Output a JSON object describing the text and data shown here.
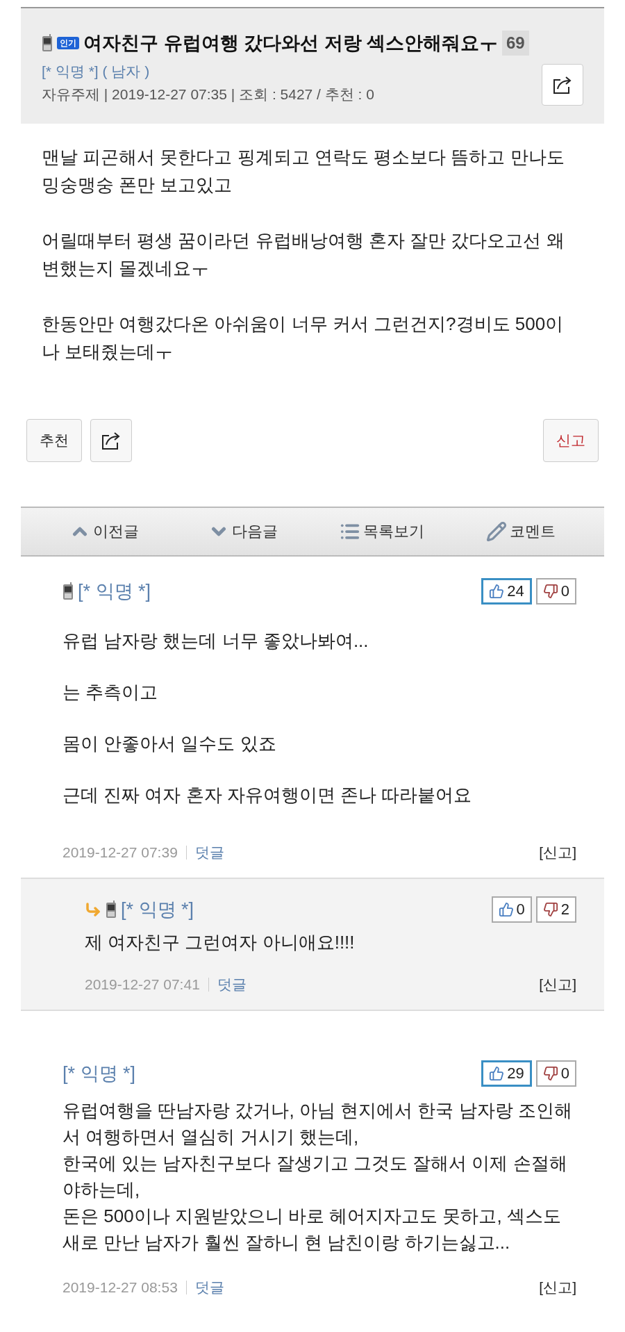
{
  "post": {
    "mobile": true,
    "badge": "인기",
    "title": "여자친구 유럽여행 갔다와선 저랑 섹스안해줘요ㅜ",
    "comment_count": "69",
    "author": "[* 익명 *]",
    "gender": "( 남자 )",
    "meta": "자유주제 | 2019-12-27 07:35 | 조회 : 5427 / 추천 : 0",
    "body": [
      "맨날 피곤해서 못한다고 핑계되고 연락도 평소보다 뜸하고 만나도 밍숭맹숭 폰만 보고있고",
      "어릴때부터 평생 꿈이라던 유럽배낭여행 혼자 잘만 갔다오고선 왜 변했는지 몰겠네요ㅜ",
      "한동안만 여행갔다온 아쉬움이 너무 커서 그런건지?경비도 500이나 보태줬는데ㅜ"
    ]
  },
  "actions": {
    "recommend": "추천",
    "report": "신고"
  },
  "nav": [
    {
      "kind": "prev",
      "label": "이전글"
    },
    {
      "kind": "next",
      "label": "다음글"
    },
    {
      "kind": "list",
      "label": "목록보기"
    },
    {
      "kind": "comment",
      "label": "코멘트"
    }
  ],
  "comments": [
    {
      "kind": "comment",
      "mobile": true,
      "author": "[* 익명 *]",
      "up": "24",
      "up_highlighted": true,
      "down": "0",
      "spaced": true,
      "lines": [
        "유럽 남자랑 했는데 너무 좋았나봐여...",
        "는 추측이고",
        "몸이 안좋아서 일수도 있죠",
        "근데 진짜 여자 혼자 자유여행이면 존나 따라붙어요"
      ],
      "date": "2019-12-27 07:39",
      "reply": "덧글",
      "report": "[신고]"
    },
    {
      "kind": "reply",
      "mobile": true,
      "author": "[* 익명 *]",
      "up": "0",
      "up_highlighted": false,
      "down": "2",
      "spaced": false,
      "lines": [
        "제 여자친구 그런여자 아니애요!!!!"
      ],
      "date": "2019-12-27 07:41",
      "reply": "덧글",
      "report": "[신고]"
    },
    {
      "kind": "comment",
      "mobile": false,
      "author": "[* 익명 *]",
      "up": "29",
      "up_highlighted": true,
      "down": "0",
      "spaced": false,
      "lines": [
        "유럽여행을 딴남자랑 갔거나, 아님 현지에서 한국 남자랑 조인해서 여행하면서 열심히 거시기 했는데,",
        "한국에 있는 남자친구보다 잘생기고 그것도 잘해서 이제 손절해야하는데,",
        "돈은 500이나 지원받았으니 바로 헤어지자고도 못하고, 섹스도 새로 만난 남자가 훨씬 잘하니 현 남친이랑 하기는싫고..."
      ],
      "date": "2019-12-27 08:53",
      "reply": "덧글",
      "report": "[신고]"
    }
  ]
}
